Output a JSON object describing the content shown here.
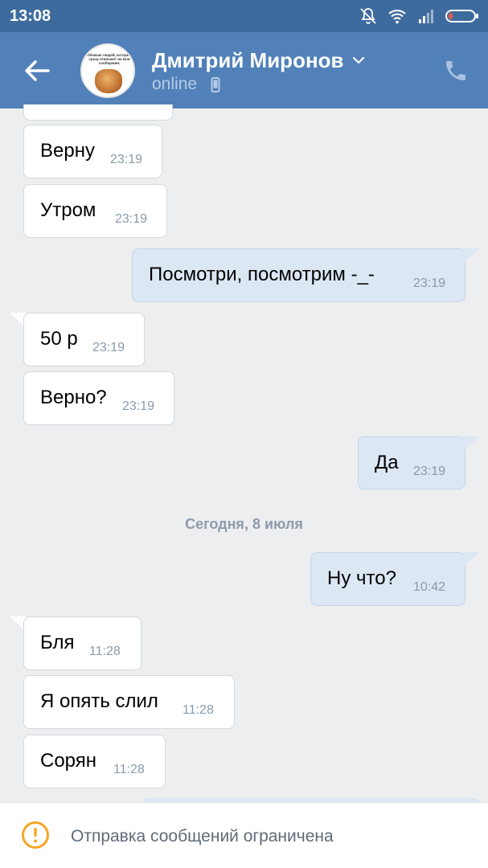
{
  "statusbar": {
    "time": "13:08"
  },
  "header": {
    "contact_name": "Дмитрий Миронов",
    "status": "online",
    "avatar_text": "Обожаю людей, которые сразу отвечают на мои сообщения."
  },
  "messages": [
    {
      "direction": "in",
      "text": "Верну",
      "time": "23:19"
    },
    {
      "direction": "in",
      "text": "Утром",
      "time": "23:19"
    },
    {
      "direction": "out",
      "text": "Посмотри, посмотрим -_-",
      "time": "23:19"
    },
    {
      "direction": "in",
      "text": "50 р",
      "time": "23:19"
    },
    {
      "direction": "in",
      "text": "Верно?",
      "time": "23:19"
    },
    {
      "direction": "out",
      "text": "Да",
      "time": "23:19"
    },
    {
      "direction": "out",
      "text": "Ну что?",
      "time": "10:42"
    },
    {
      "direction": "in",
      "text": "Бля",
      "time": "11:28"
    },
    {
      "direction": "in",
      "text": "Я опять слил",
      "time": "11:28"
    },
    {
      "direction": "in",
      "text": "Сорян",
      "time": "11:28"
    }
  ],
  "date_separator": "Сегодня, 8 июля",
  "footer": {
    "notice": "Отправка сообщений ограничена"
  },
  "colors": {
    "header": "#5181b8",
    "statusbar": "#3e6b9e",
    "background": "#edeef0",
    "outgoing_bubble": "#dce7f4",
    "incoming_bubble": "#ffffff",
    "warning": "#f5a623"
  },
  "icons": [
    "no-disturb-icon",
    "wifi-icon",
    "signal-icon",
    "battery-icon",
    "back-arrow-icon",
    "chevron-down-icon",
    "mobile-phone-icon",
    "call-icon",
    "warning-icon"
  ]
}
